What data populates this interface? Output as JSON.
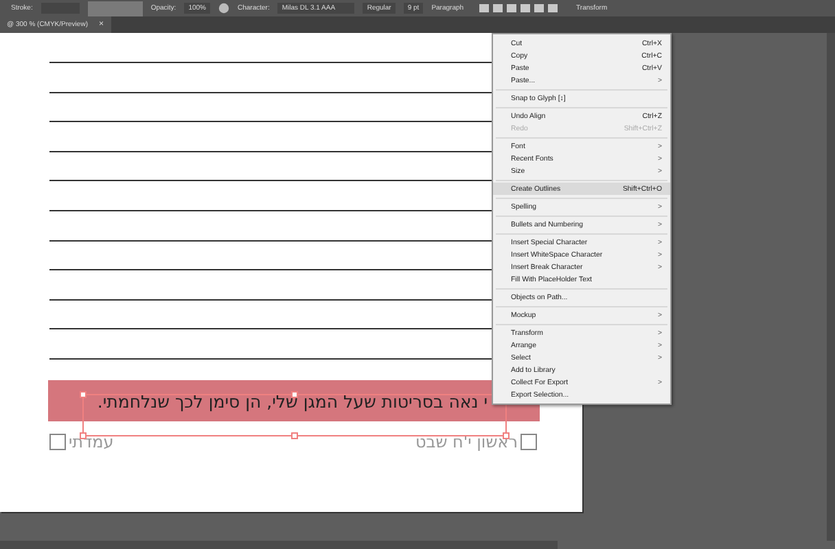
{
  "control_bar": {
    "items": [
      {
        "kind": "label",
        "text": "Stroke:"
      },
      {
        "kind": "dropdown"
      },
      {
        "kind": "swatch"
      },
      {
        "kind": "label",
        "text": "Opacity:"
      },
      {
        "kind": "field",
        "text": "100%"
      },
      {
        "kind": "globe"
      },
      {
        "kind": "label",
        "text": "Character:"
      },
      {
        "kind": "font",
        "text": "Milas DL 3.1 AAA"
      },
      {
        "kind": "field",
        "text": "Regular"
      },
      {
        "kind": "field",
        "text": "9 pt"
      },
      {
        "kind": "label",
        "text": "Paragraph"
      },
      {
        "kind": "aligns"
      },
      {
        "kind": "label",
        "text": "Transform"
      }
    ]
  },
  "document_tab": {
    "title": "@ 300 % (CMYK/Preview)",
    "close": "×"
  },
  "artboard": {
    "highlight_text": "י נאה בסריטות שעל המגן שלי, הן סימן לכך שנלחמתי.",
    "checkboxes": [
      {
        "label": "ראשון י'ח שבט",
        "checked": false
      },
      {
        "label": "עמדתי",
        "checked": false
      }
    ]
  },
  "context_menu": {
    "groups": [
      [
        {
          "label": "Cut",
          "shortcut": "Ctrl+X",
          "submenu": false,
          "disabled": false,
          "selected": false
        },
        {
          "label": "Copy",
          "shortcut": "Ctrl+C",
          "submenu": false,
          "disabled": false,
          "selected": false
        },
        {
          "label": "Paste",
          "shortcut": "Ctrl+V",
          "submenu": false,
          "disabled": false,
          "selected": false
        },
        {
          "label": "Paste...",
          "submenu": true,
          "disabled": false,
          "selected": false
        }
      ],
      [
        {
          "label": "Snap to Glyph [↕]",
          "submenu": false,
          "disabled": false,
          "selected": false
        }
      ],
      [
        {
          "label": "Undo Align",
          "shortcut": "Ctrl+Z",
          "submenu": false,
          "disabled": false,
          "selected": false
        },
        {
          "label": "Redo",
          "shortcut": "Shift+Ctrl+Z",
          "submenu": false,
          "disabled": true,
          "selected": false
        }
      ],
      [
        {
          "label": "Font",
          "submenu": true,
          "disabled": false,
          "selected": false
        },
        {
          "label": "Recent Fonts",
          "submenu": true,
          "disabled": false,
          "selected": false
        },
        {
          "label": "Size",
          "submenu": true,
          "disabled": false,
          "selected": false
        }
      ],
      [
        {
          "label": "Create Outlines",
          "shortcut": "Shift+Ctrl+O",
          "submenu": false,
          "disabled": false,
          "selected": true
        }
      ],
      [
        {
          "label": "Spelling",
          "submenu": true,
          "disabled": false,
          "selected": false
        }
      ],
      [
        {
          "label": "Bullets and Numbering",
          "submenu": true,
          "disabled": false,
          "selected": false
        }
      ],
      [
        {
          "label": "Insert Special Character",
          "submenu": true,
          "disabled": false,
          "selected": false
        },
        {
          "label": "Insert WhiteSpace Character",
          "submenu": true,
          "disabled": false,
          "selected": false
        },
        {
          "label": "Insert Break Character",
          "submenu": true,
          "disabled": false,
          "selected": false
        },
        {
          "label": "Fill With PlaceHolder Text",
          "submenu": false,
          "disabled": false,
          "selected": false
        }
      ],
      [
        {
          "label": "Objects on Path...",
          "submenu": false,
          "disabled": false,
          "selected": false
        }
      ],
      [
        {
          "label": "Mockup",
          "submenu": true,
          "disabled": false,
          "selected": false
        }
      ],
      [
        {
          "label": "Transform",
          "submenu": true,
          "disabled": false,
          "selected": false
        },
        {
          "label": "Arrange",
          "submenu": true,
          "disabled": false,
          "selected": false
        },
        {
          "label": "Select",
          "submenu": true,
          "disabled": false,
          "selected": false
        },
        {
          "label": "Add to Library",
          "submenu": false,
          "disabled": false,
          "selected": false
        },
        {
          "label": "Collect For Export",
          "submenu": true,
          "disabled": false,
          "selected": false
        },
        {
          "label": "Export Selection...",
          "submenu": false,
          "disabled": false,
          "selected": false
        }
      ]
    ],
    "submenu_arrow": ">"
  }
}
